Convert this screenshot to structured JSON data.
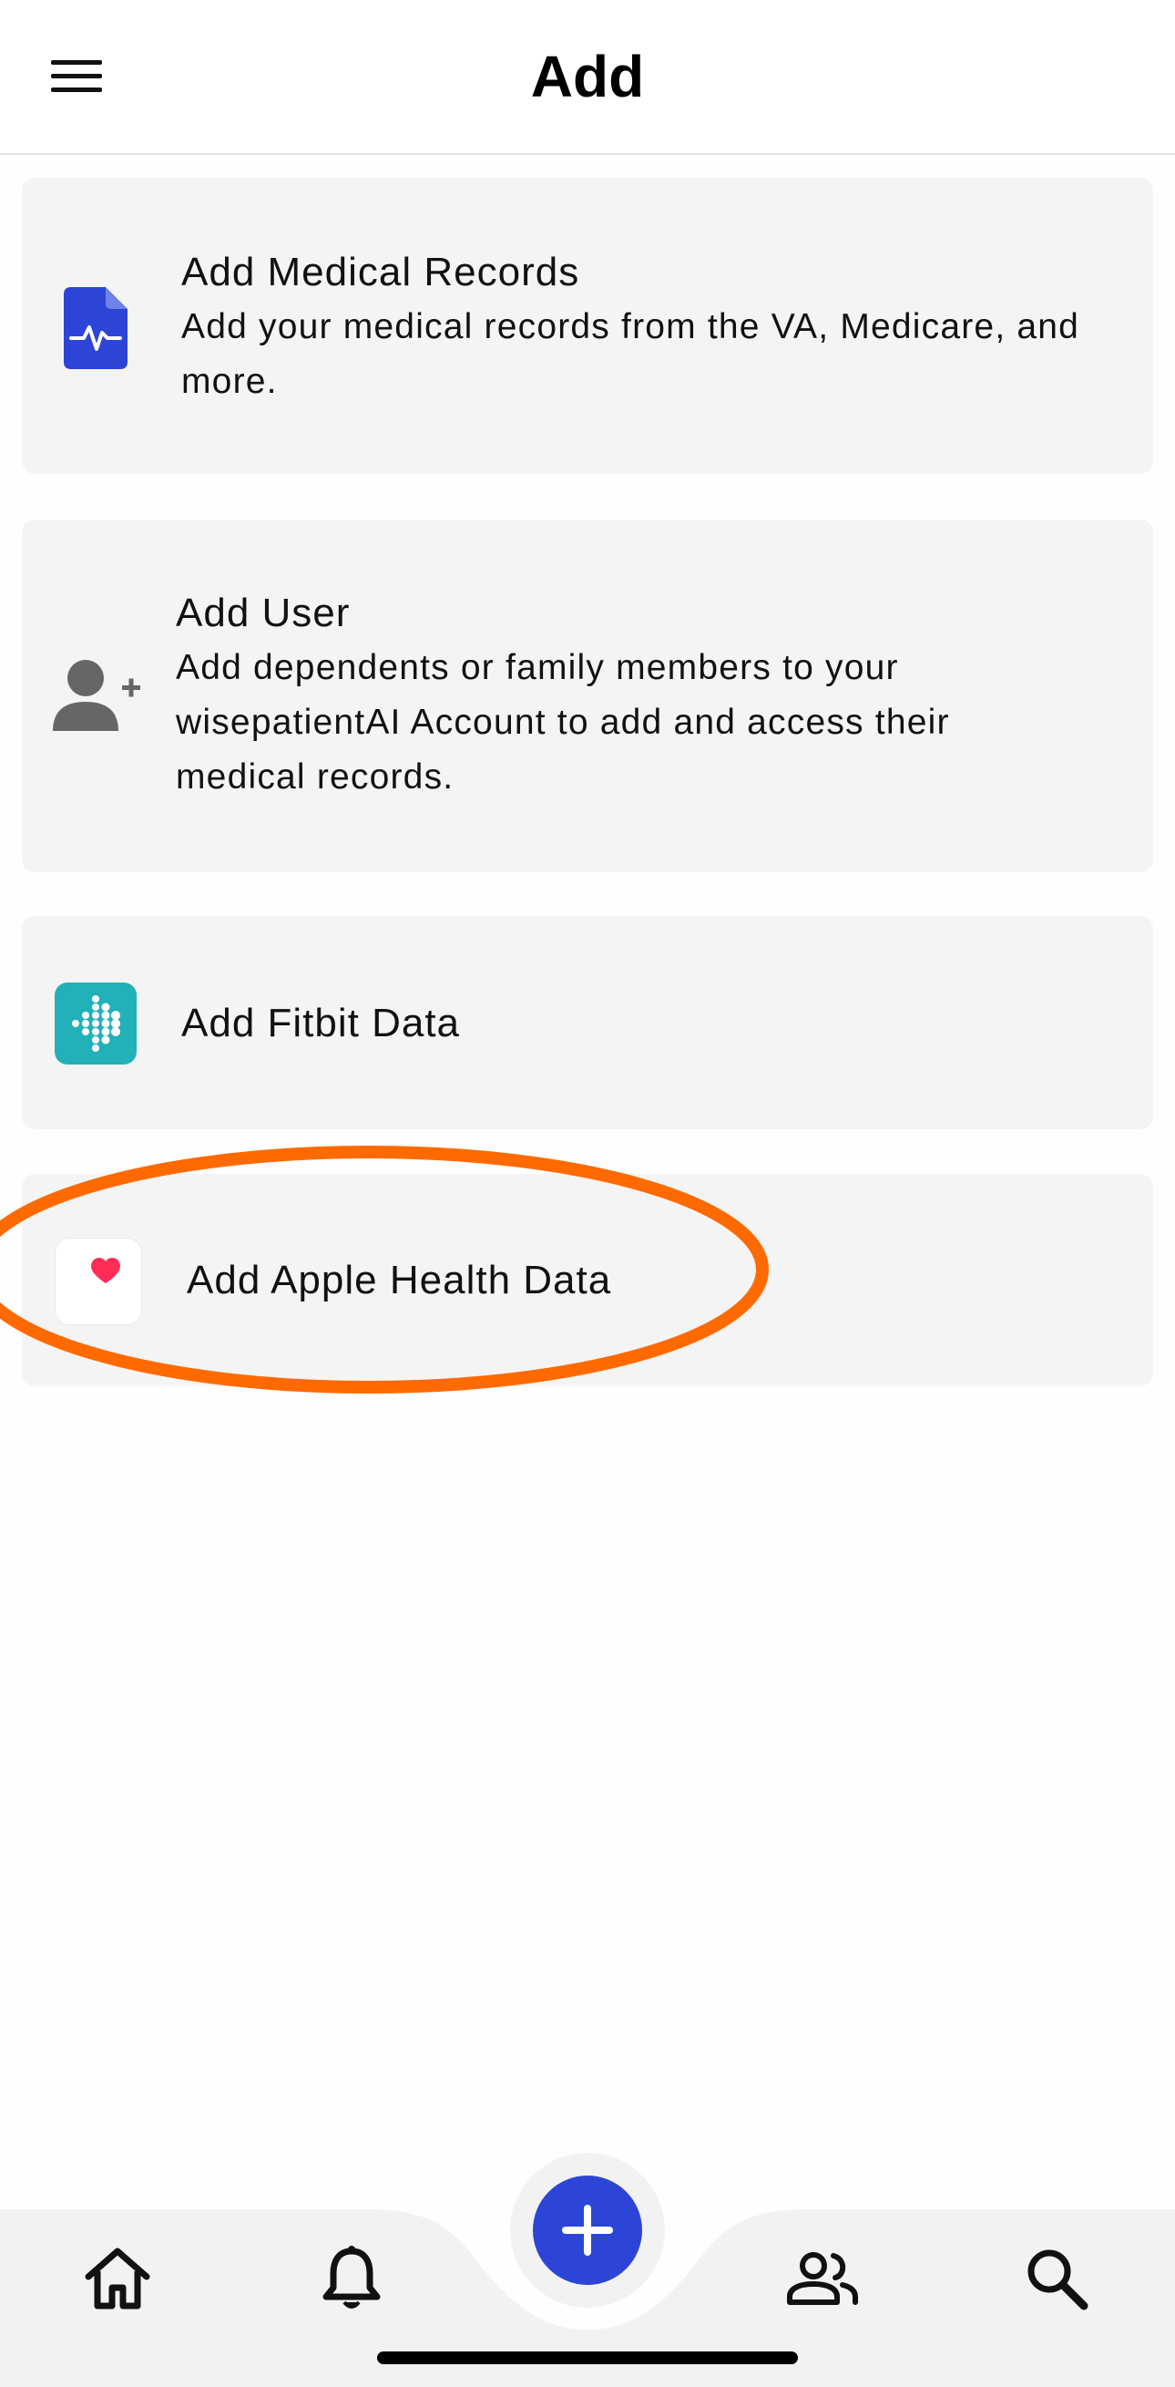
{
  "header": {
    "title": "Add",
    "menu_icon": "hamburger-menu-icon"
  },
  "cards": [
    {
      "title": "Add Medical Records",
      "description": "Add your medical records from the VA, Medicare, and more.",
      "icon": "medical-record-icon",
      "icon_color": "#2c45d6"
    },
    {
      "title": "Add User",
      "description": "Add dependents or family members to your wisepatientAI Account to add and access their medical records.",
      "icon": "add-user-icon",
      "icon_color": "#666666"
    },
    {
      "title": "Add Fitbit Data",
      "icon": "fitbit-icon",
      "icon_color": "#22b1b9"
    },
    {
      "title": "Add Apple Health Data",
      "icon": "apple-health-icon",
      "icon_color": "#ff2d55",
      "highlighted": true
    }
  ],
  "annotation": {
    "color": "#ff6a00",
    "shape": "ellipse around Add Apple Health Data"
  },
  "tab_bar": {
    "tabs": [
      {
        "icon": "home-icon"
      },
      {
        "icon": "bell-icon"
      },
      {
        "icon": "add-icon",
        "accent": "#2c45d6"
      },
      {
        "icon": "people-icon"
      },
      {
        "icon": "search-icon"
      }
    ],
    "background": "#f2f2f2"
  }
}
